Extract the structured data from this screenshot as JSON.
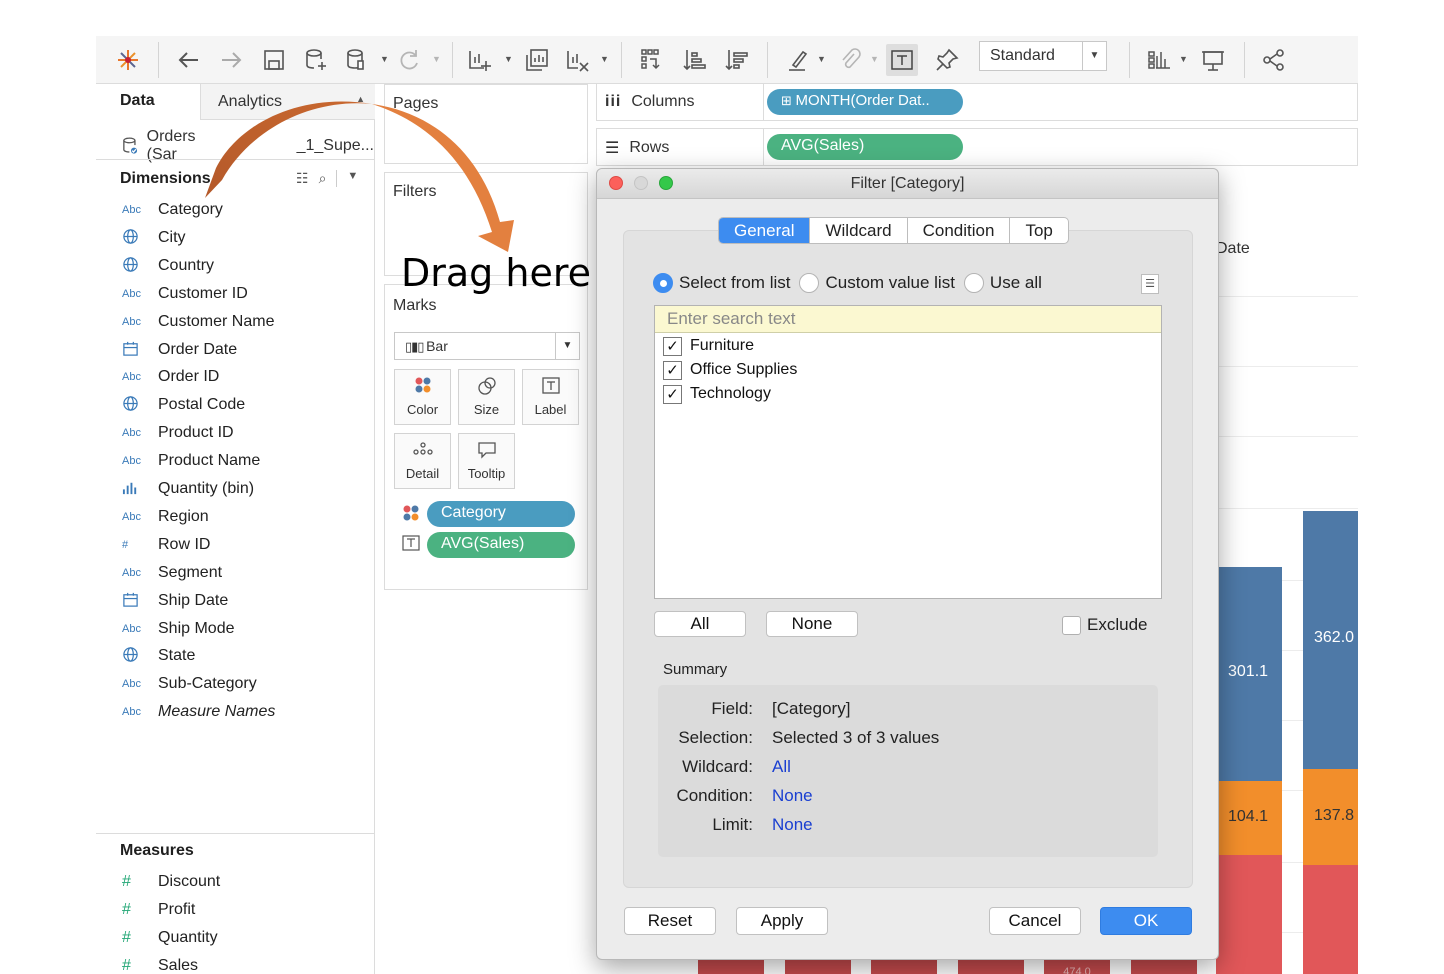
{
  "toolbar": {
    "mark_select_value": "Standard",
    "icons": [
      "tableau-logo-icon",
      "back-icon",
      "forward-icon",
      "save-icon",
      "new-datasource-icon",
      "datasource-icon",
      "refresh-icon",
      "new-worksheet-icon",
      "duplicate-icon",
      "clear-icon",
      "swap-icon",
      "sort-ascending-icon",
      "sort-descending-icon",
      "highlight-icon",
      "group-icon",
      "show-labels-icon",
      "pin-icon",
      "show-me-icon",
      "presentation-icon",
      "share-icon"
    ]
  },
  "data_pane": {
    "tabs": {
      "data": "Data",
      "analytics": "Analytics"
    },
    "datasource": "Orders (Sample - 1_Supe...",
    "datasource_visible_left": "Orders (Sar",
    "datasource_visible_right": "_1_Supe...",
    "dimensions_header": "Dimensions",
    "dimensions": [
      {
        "type": "Abc",
        "label": "Category"
      },
      {
        "type": "geo",
        "label": "City"
      },
      {
        "type": "geo",
        "label": "Country"
      },
      {
        "type": "Abc",
        "label": "Customer ID"
      },
      {
        "type": "Abc",
        "label": "Customer Name"
      },
      {
        "type": "date",
        "label": "Order Date"
      },
      {
        "type": "Abc",
        "label": "Order ID"
      },
      {
        "type": "geo",
        "label": "Postal Code"
      },
      {
        "type": "Abc",
        "label": "Product ID"
      },
      {
        "type": "Abc",
        "label": "Product Name"
      },
      {
        "type": "bin",
        "label": "Quantity (bin)"
      },
      {
        "type": "Abc",
        "label": "Region"
      },
      {
        "type": "#",
        "label": "Row ID"
      },
      {
        "type": "Abc",
        "label": "Segment"
      },
      {
        "type": "date",
        "label": "Ship Date"
      },
      {
        "type": "Abc",
        "label": "Ship Mode"
      },
      {
        "type": "geo",
        "label": "State"
      },
      {
        "type": "Abc",
        "label": "Sub-Category"
      },
      {
        "type": "Abc",
        "label": "Measure Names"
      }
    ],
    "measures_header": "Measures",
    "measures": [
      {
        "type": "#",
        "label": "Discount"
      },
      {
        "type": "#",
        "label": "Profit"
      },
      {
        "type": "#",
        "label": "Quantity"
      },
      {
        "type": "#",
        "label": "Sales"
      }
    ]
  },
  "cards": {
    "pages": "Pages",
    "filters": "Filters",
    "marks": "Marks",
    "mark_type": "Bar",
    "mark_buttons": [
      "Color",
      "Size",
      "Label",
      "Detail",
      "Tooltip"
    ],
    "mark_pills": [
      "Category",
      "AVG(Sales)"
    ]
  },
  "annotation": {
    "drag_here": "Drag here"
  },
  "shelves": {
    "columns_label": "Columns",
    "columns_pill": "MONTH(Order Dat..",
    "rows_label": "Rows",
    "rows_pill": "AVG(Sales)"
  },
  "chart": {
    "axis_title_visible": "Date",
    "bar_labels": [
      "301.1",
      "104.1",
      "362.0",
      "137.8",
      "474.0"
    ],
    "colors": {
      "technology": "#4e79a7",
      "office_supplies": "#f28e2b",
      "furniture": "#e15759"
    }
  },
  "dialog": {
    "title": "Filter [Category]",
    "tabs": [
      "General",
      "Wildcard",
      "Condition",
      "Top"
    ],
    "active_tab": "General",
    "radio_options": [
      "Select from list",
      "Custom value list",
      "Use all"
    ],
    "selected_radio": "Select from list",
    "search_placeholder": "Enter search text",
    "items": [
      {
        "label": "Furniture",
        "checked": true
      },
      {
        "label": "Office Supplies",
        "checked": true
      },
      {
        "label": "Technology",
        "checked": true
      }
    ],
    "all_button": "All",
    "none_button": "None",
    "exclude_label": "Exclude",
    "summary_label": "Summary",
    "summary": {
      "field_key": "Field:",
      "field_val": "[Category]",
      "selection_key": "Selection:",
      "selection_val": "Selected 3 of 3 values",
      "wildcard_key": "Wildcard:",
      "wildcard_val": "All",
      "condition_key": "Condition:",
      "condition_val": "None",
      "limit_key": "Limit:",
      "limit_val": "None"
    },
    "buttons": {
      "reset": "Reset",
      "apply": "Apply",
      "cancel": "Cancel",
      "ok": "OK"
    },
    "accent": "#3d8cf0"
  }
}
